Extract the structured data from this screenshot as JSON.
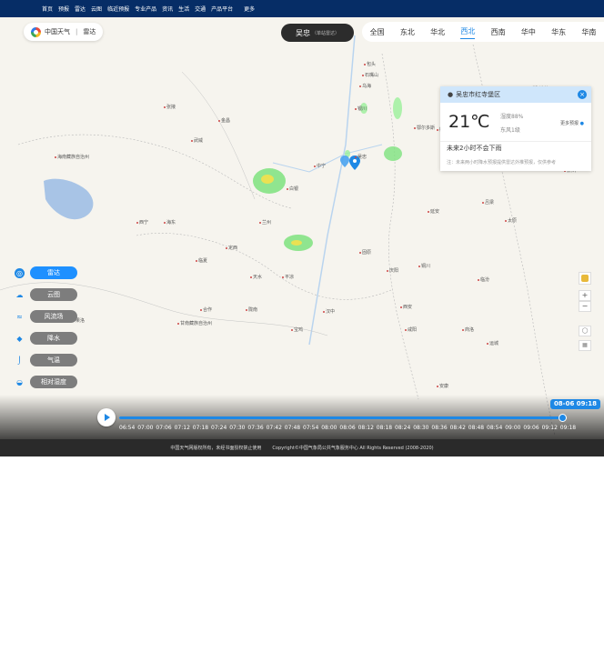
{
  "topnav": {
    "items": [
      "首页",
      "预报",
      "雷达",
      "云图",
      "临近预报",
      "专业产品",
      "资讯",
      "生活",
      "交通",
      "产品平台"
    ],
    "more": "更多"
  },
  "brand": {
    "name": "中国天气",
    "section": "雷达"
  },
  "city_pill": {
    "city": "吴忠",
    "sub": "（单站雷达）"
  },
  "regions": {
    "items": [
      "全国",
      "东北",
      "华北",
      "西北",
      "西南",
      "华中",
      "华东",
      "华南"
    ],
    "active": "西北"
  },
  "popup": {
    "location": "吴忠市红寺堡区",
    "temperature": "21℃",
    "humidity": "湿度88%",
    "wind": "东风1级",
    "more": "更多预报",
    "forecast": "未来2小时不会下雨",
    "note": "注：未来两小时降水预报提供雷达外推预报，仅供参考"
  },
  "layers": {
    "items": [
      {
        "label": "雷达",
        "icon": "radar-icon",
        "active": true
      },
      {
        "label": "云图",
        "icon": "cloud-icon",
        "active": false
      },
      {
        "label": "风流场",
        "icon": "wind-icon",
        "active": false
      },
      {
        "label": "降水",
        "icon": "rain-icon",
        "active": false
      },
      {
        "label": "气温",
        "icon": "thermometer-icon",
        "active": false
      },
      {
        "label": "相对湿度",
        "icon": "humidity-icon",
        "active": false
      }
    ]
  },
  "map_labels": [
    "银川",
    "吴忠",
    "中宁",
    "固原",
    "兰州",
    "西宁",
    "定西",
    "天水",
    "平凉",
    "庆阳",
    "延安",
    "榆林",
    "鄂尔多斯",
    "包头",
    "呼和浩特",
    "乌海",
    "石嘴山",
    "白银",
    "武威",
    "张掖",
    "金昌",
    "临夏",
    "合作",
    "陇南",
    "汉中",
    "宝鸡",
    "西安",
    "铜川",
    "咸阳",
    "商洛",
    "安康",
    "海东",
    "海南藏族自治州",
    "果洛",
    "甘南藏族自治州",
    "大同",
    "朔州",
    "忻州",
    "太原",
    "吕梁",
    "临汾",
    "运城"
  ],
  "timeline": {
    "current": "08-06 09:18",
    "progress": 0.99,
    "ticks": [
      "06:54",
      "07:00",
      "07:06",
      "07:12",
      "07:18",
      "07:24",
      "07:30",
      "07:36",
      "07:42",
      "07:48",
      "07:54",
      "08:00",
      "08:06",
      "08:12",
      "08:18",
      "08:24",
      "08:30",
      "08:36",
      "08:42",
      "08:48",
      "08:54",
      "09:00",
      "09:06",
      "09:12",
      "09:18"
    ]
  },
  "footer": {
    "left": "中国天气网版权所有，未经书面授权禁止使用",
    "right": "Copyright©中国气象局公共气象服务中心 All Rights Reserved (2008-2020)"
  },
  "colors": {
    "accent": "#1e88e5",
    "nav": "#062d66",
    "radar_green": "#7ee27e",
    "radar_yellow": "#f4e04d"
  }
}
